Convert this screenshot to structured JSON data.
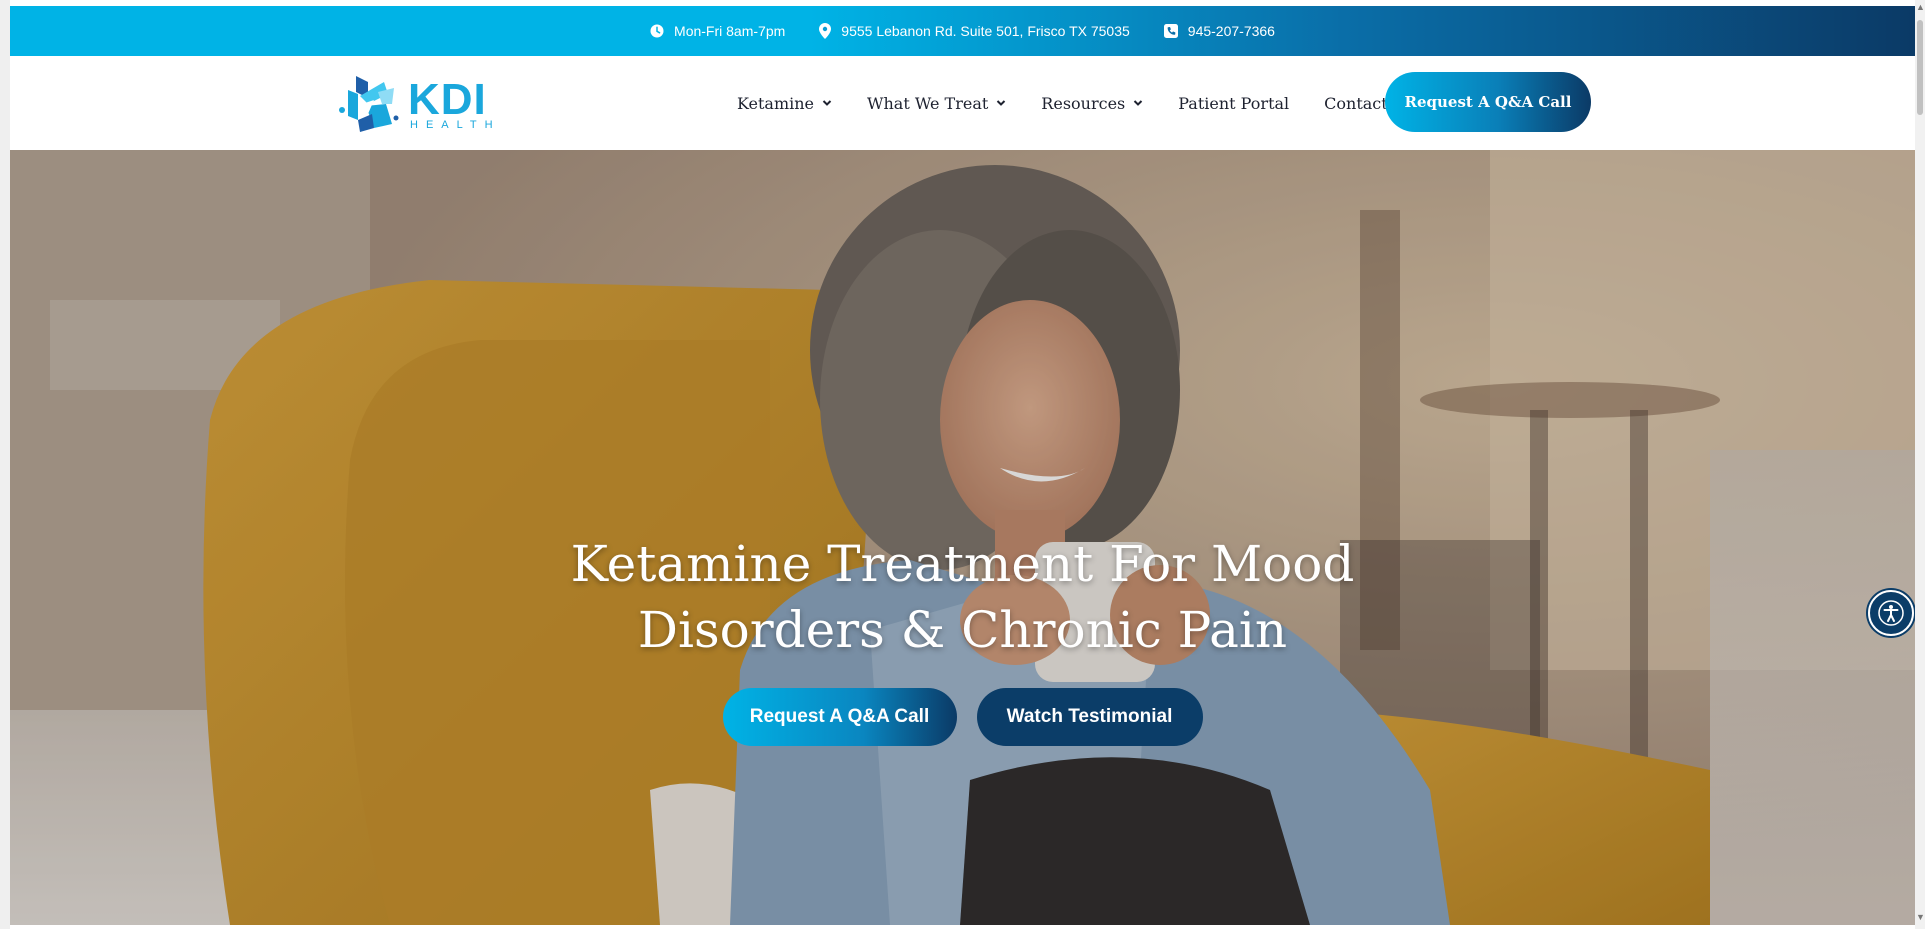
{
  "topbar": {
    "hours": "Mon-Fri 8am-7pm",
    "address": "9555 Lebanon Rd. Suite 501, Frisco TX 75035",
    "phone": "945-207-7366",
    "icons": [
      "clock-icon",
      "map-pin-icon",
      "phone-icon"
    ]
  },
  "logo": {
    "wordmark": "KDI",
    "subword": "HEALTH"
  },
  "nav": {
    "items": [
      {
        "label": "Ketamine",
        "dropdown": true
      },
      {
        "label": "What We Treat",
        "dropdown": true
      },
      {
        "label": "Resources",
        "dropdown": true
      },
      {
        "label": "Patient Portal",
        "dropdown": false
      },
      {
        "label": "Contact",
        "dropdown": false
      }
    ],
    "cta": "Request A Q&A Call"
  },
  "hero": {
    "title_line1": "Ketamine Treatment For Mood",
    "title_line2": "Disorders & Chronic Pain",
    "primary_button": "Request A Q&A Call",
    "secondary_button": "Watch Testimonial"
  },
  "accessibility": {
    "icon": "accessibility-icon"
  },
  "colors": {
    "brand_cyan": "#00b3e6",
    "brand_navy": "#0b3d68",
    "nav_text": "#1e2230"
  }
}
